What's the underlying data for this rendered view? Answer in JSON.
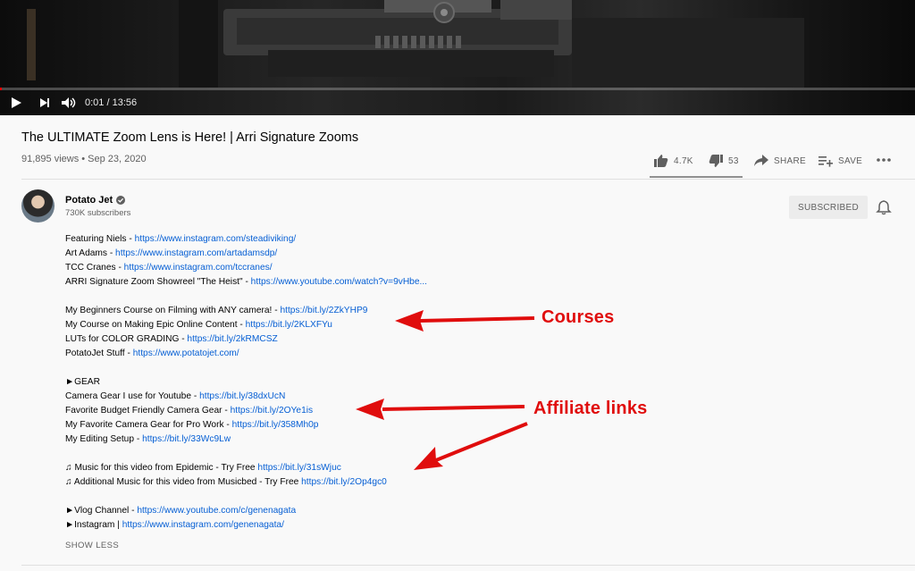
{
  "player": {
    "time": "0:01 / 13:56",
    "progress_fraction": 0.0012,
    "controls": [
      "play-icon",
      "next-icon",
      "volume-icon"
    ]
  },
  "video": {
    "title": "The ULTIMATE Zoom Lens is Here! | Arri Signature Zooms",
    "meta": "91,895 views • Sep 23, 2020"
  },
  "actions": {
    "likes": "4.7K",
    "dislikes": "53",
    "share": "SHARE",
    "save": "SAVE"
  },
  "channel": {
    "name": "Potato Jet",
    "subscribers": "730K subscribers",
    "subscribe_label": "SUBSCRIBED"
  },
  "description": [
    {
      "text": "Featuring Niels - ",
      "link": "https://www.instagram.com/steadiviking/"
    },
    {
      "text": "Art Adams - ",
      "link": "https://www.instagram.com/artadamsdp/"
    },
    {
      "text": "TCC Cranes - ",
      "link": "https://www.instagram.com/tccranes/"
    },
    {
      "text": "ARRI Signature Zoom Showreel \"The Heist\" - ",
      "link": "https://www.youtube.com/watch?v=9vHbe..."
    },
    {
      "text": "",
      "link": ""
    },
    {
      "text": "My Beginners Course on Filming with ANY camera! - ",
      "link": "https://bit.ly/2ZkYHP9"
    },
    {
      "text": "My Course on Making Epic Online Content - ",
      "link": "https://bit.ly/2KLXFYu"
    },
    {
      "text": "LUTs for COLOR GRADING - ",
      "link": "https://bit.ly/2kRMCSZ"
    },
    {
      "text": "PotatoJet Stuff - ",
      "link": "https://www.potatojet.com/"
    },
    {
      "text": "",
      "link": ""
    },
    {
      "text": "►GEAR",
      "link": ""
    },
    {
      "text": "Camera Gear I use for Youtube - ",
      "link": "https://bit.ly/38dxUcN"
    },
    {
      "text": "Favorite Budget Friendly Camera Gear - ",
      "link": "https://bit.ly/2OYe1is"
    },
    {
      "text": "My Favorite Camera Gear for Pro Work - ",
      "link": "https://bit.ly/358Mh0p"
    },
    {
      "text": "My Editing Setup - ",
      "link": "https://bit.ly/33Wc9Lw"
    },
    {
      "text": "",
      "link": ""
    },
    {
      "text": "♫ Music for this video from Epidemic - Try Free  ",
      "link": "https://bit.ly/31sWjuc"
    },
    {
      "text": "♫ Additional Music for this video from Musicbed - Try Free  ",
      "link": "https://bit.ly/2Op4gc0"
    },
    {
      "text": "",
      "link": ""
    },
    {
      "text": "►Vlog Channel - ",
      "link": "https://www.youtube.com/c/genenagata"
    },
    {
      "text": "►Instagram | ",
      "link": "https://www.instagram.com/genenagata/"
    }
  ],
  "show_less": "SHOW LESS",
  "annotations": {
    "courses": "Courses",
    "affiliate": "Affiliate links",
    "color": "#e00d0d"
  }
}
